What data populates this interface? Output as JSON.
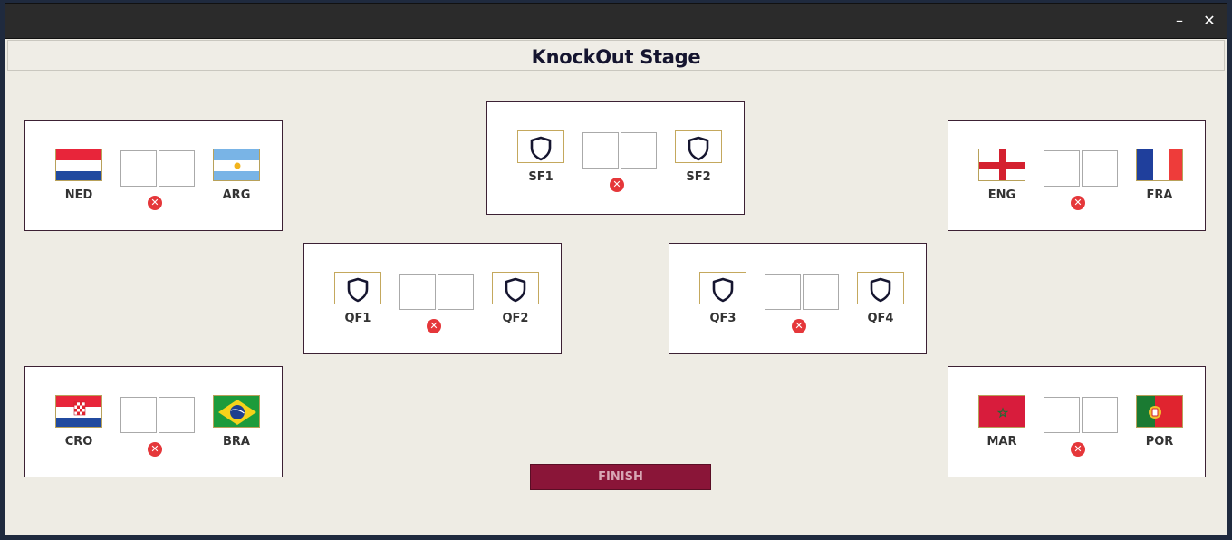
{
  "window": {
    "minimize_glyph": "–",
    "close_glyph": "✕"
  },
  "header": {
    "title": "KnockOut Stage"
  },
  "matches": {
    "r16_top_left": {
      "home": "NED",
      "away": "ARG",
      "home_flag": "netherlands-flag",
      "away_flag": "argentina-flag",
      "home_score": "",
      "away_score": ""
    },
    "r16_bottom_left": {
      "home": "CRO",
      "away": "BRA",
      "home_flag": "croatia-flag",
      "away_flag": "brazil-flag",
      "home_score": "",
      "away_score": ""
    },
    "r16_top_right": {
      "home": "ENG",
      "away": "FRA",
      "home_flag": "england-flag",
      "away_flag": "france-flag",
      "home_score": "",
      "away_score": ""
    },
    "r16_bottom_right": {
      "home": "MAR",
      "away": "POR",
      "home_flag": "morocco-flag",
      "away_flag": "portugal-flag",
      "home_score": "",
      "away_score": ""
    },
    "qf_left": {
      "home": "QF1",
      "away": "QF2",
      "home_score": "",
      "away_score": ""
    },
    "qf_right": {
      "home": "QF3",
      "away": "QF4",
      "home_score": "",
      "away_score": ""
    },
    "sf": {
      "home": "SF1",
      "away": "SF2",
      "home_score": "",
      "away_score": ""
    }
  },
  "reset_glyph": "✕",
  "finish_button": {
    "label": "FINISH"
  },
  "colors": {
    "accent": "#8a1538",
    "frame": "#3c2134",
    "slot_border": "#c4a85d",
    "reset": "#e5373a"
  }
}
